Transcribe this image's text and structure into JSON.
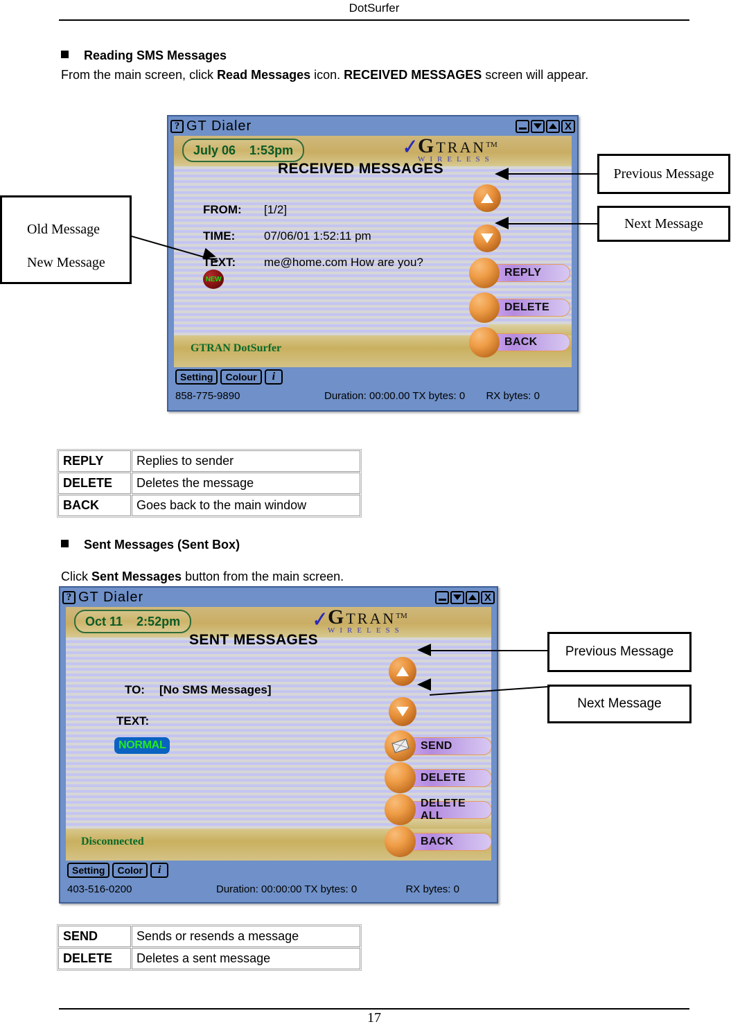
{
  "document": {
    "header_title": "DotSurfer",
    "page_number": "17"
  },
  "section1": {
    "heading": "Reading SMS Messages",
    "paragraph_parts": [
      "From the main screen, click ",
      "Read Messages",
      " icon. ",
      "RECEIVED MESSAGES",
      " screen will appear."
    ],
    "callouts": {
      "previous": "Previous Message",
      "next": "Next Message",
      "old": "Old Message",
      "new": "New Message"
    },
    "table": {
      "rows": [
        {
          "key": "REPLY",
          "value": "Replies to sender"
        },
        {
          "key": "DELETE",
          "value": "Deletes the message"
        },
        {
          "key": "BACK",
          "value": "Goes back to the main window"
        }
      ]
    }
  },
  "section2": {
    "heading": "Sent Messages (Sent Box)",
    "paragraph_parts": [
      "Click ",
      "Sent Messages",
      " button from the main screen."
    ],
    "callouts": {
      "previous": "Previous Message",
      "next": "Next Message"
    },
    "table": {
      "rows": [
        {
          "key": "SEND",
          "value": "Sends or resends a message"
        },
        {
          "key": "DELETE",
          "value": "Deletes a sent message"
        }
      ]
    }
  },
  "received_window": {
    "titlebar": {
      "help_glyph": "?",
      "title": "GT Dialer",
      "buttons": [
        "minimize",
        "restore-down",
        "maximize-up",
        "close"
      ]
    },
    "date": "July 06",
    "time": "1:53pm",
    "screen_title": "RECEIVED MESSAGES",
    "brand": {
      "main_first": "G",
      "main_rest": "TRAN",
      "tm": "TM",
      "sub": "WIRELESS"
    },
    "fields": [
      {
        "label": "FROM:",
        "value": "[1/2]"
      },
      {
        "label": "TIME:",
        "value": "07/06/01  1:52:11 pm"
      },
      {
        "label": "TEXT:",
        "value": "me@home.com  How are you?"
      }
    ],
    "new_badge": "NEW",
    "nav": {
      "up": "previous-message",
      "down": "next-message"
    },
    "actions": [
      "REPLY",
      "DELETE",
      "BACK"
    ],
    "status_word": "GTRAN DotSurfer",
    "bottom_buttons": [
      "Setting",
      "Colour",
      "i"
    ],
    "statusbar": {
      "phone": "858-775-9890",
      "duration": "Duration:  00:00.00  TX bytes:  0",
      "rx": "RX bytes:  0"
    }
  },
  "sent_window": {
    "titlebar": {
      "help_glyph": "?",
      "title": "GT Dialer",
      "buttons": [
        "minimize",
        "restore-down",
        "maximize-up",
        "close"
      ]
    },
    "date": "Oct 11",
    "time": "2:52pm",
    "screen_title": "SENT MESSAGES",
    "brand": {
      "main_first": "G",
      "main_rest": "TRAN",
      "tm": "TM",
      "sub": "WIRELESS"
    },
    "fields": [
      {
        "label": "TO:",
        "value": "[No SMS Messages]"
      },
      {
        "label": "TEXT:",
        "value": ""
      }
    ],
    "normal_badge": "NORMAL",
    "nav": {
      "up": "previous-message",
      "down": "next-message"
    },
    "actions": [
      "SEND",
      "DELETE",
      "DELETE ALL",
      "BACK"
    ],
    "status_word": "Disconnected",
    "bottom_buttons": [
      "Setting",
      "Color",
      "i"
    ],
    "statusbar": {
      "phone": "403-516-0200",
      "duration": "Duration:  00:00:00  TX bytes:  0",
      "rx": "RX bytes:  0"
    }
  },
  "colors": {
    "window_chrome": "#6f90c8",
    "gold_band": "#c9b05f",
    "sphere_orange": "#ef9c46",
    "pill_purple": "#b48be0",
    "status_green": "#0a6a2a",
    "badge_red": "#8c1414",
    "badge_blue": "#0a63c0"
  }
}
